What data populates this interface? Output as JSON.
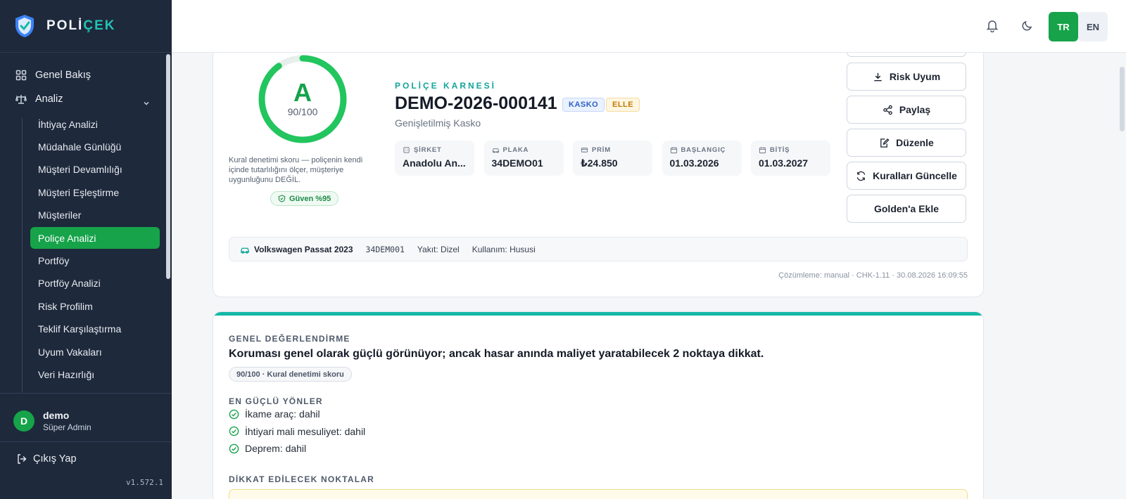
{
  "brand": {
    "name_part1": "POLİ",
    "name_part2": "ÇEK"
  },
  "nav": {
    "overview": "Genel Bakış",
    "analysis": "Analiz",
    "sub_items": [
      {
        "label": "İhtiyaç Analizi",
        "active": false
      },
      {
        "label": "Müdahale Günlüğü",
        "active": false
      },
      {
        "label": "Müşteri Devamlılığı",
        "active": false
      },
      {
        "label": "Müşteri Eşleştirme",
        "active": false
      },
      {
        "label": "Müşteriler",
        "active": false
      },
      {
        "label": "Poliçe Analizi",
        "active": true
      },
      {
        "label": "Portföy",
        "active": false
      },
      {
        "label": "Portföy Analizi",
        "active": false
      },
      {
        "label": "Risk Profilim",
        "active": false
      },
      {
        "label": "Teklif Karşılaştırma",
        "active": false
      },
      {
        "label": "Uyum Vakaları",
        "active": false
      },
      {
        "label": "Veri Hazırlığı",
        "active": false
      }
    ]
  },
  "user": {
    "initial": "D",
    "name": "demo",
    "role": "Süper Admin"
  },
  "logout": "Çıkış Yap",
  "version": "v1.572.1",
  "topbar": {
    "lang_tr": "TR",
    "lang_en": "EN",
    "active_lang": "TR"
  },
  "policy": {
    "grade": "A",
    "score_text": "90/100",
    "score_value": 90,
    "score_note": "Kural denetimi skoru — poliçenin kendi içinde tutarlılığını ölçer, müşteriye uygunluğunu DEĞİL.",
    "trust": "Güven %95",
    "eyebrow": "POLİÇE KARNESİ",
    "number": "DEMO-2026-000141",
    "badge_type": "KASKO",
    "badge_source": "ELLE",
    "subtitle": "Genişletilmiş Kasko",
    "info": [
      {
        "label": "ŞİRKET",
        "value": "Anadolu An...",
        "icon": "building-icon"
      },
      {
        "label": "PLAKA",
        "value": "34DEMO01",
        "icon": "car-icon"
      },
      {
        "label": "PRİM",
        "value": "₺24.850",
        "icon": "card-icon"
      },
      {
        "label": "BAŞLANGIÇ",
        "value": "01.03.2026",
        "icon": "calendar-icon"
      },
      {
        "label": "BİTİŞ",
        "value": "01.03.2027",
        "icon": "calendar-icon"
      }
    ],
    "actions": {
      "risk_uyum": "Risk Uyum",
      "share": "Paylaş",
      "edit": "Düzenle",
      "update_rules": "Kuralları Güncelle",
      "add_golden": "Golden'a Ekle"
    },
    "vehicle": {
      "name": "Volkswagen Passat 2023",
      "plate": "34DEM001",
      "fuel": "Yakıt: Dizel",
      "usage": "Kullanım: Husus‍i"
    },
    "resolution": "Çözümleme: manual · CHK-1.11 · 30.08.2026 16:09:55"
  },
  "assessment": {
    "label": "GENEL DEĞERLENDİRME",
    "summary": "Koruması genel olarak güçlü görünüyor; ancak hasar anında maliyet yaratabilecek 2 noktaya dikkat.",
    "score_pill": "90/100 · Kural denetimi skoru",
    "strengths_label": "EN GÜÇLÜ YÖNLER",
    "strengths": [
      "İkame araç: dahil",
      "İhtiyari mali mesuliyet: dahil",
      "Deprem: dahil"
    ],
    "attention_label": "DİKKAT EDİLECEK NOKTALAR"
  },
  "colors": {
    "accent_green": "#16a34a",
    "accent_teal": "#14b8a6",
    "sidebar_bg": "#1e293b"
  }
}
